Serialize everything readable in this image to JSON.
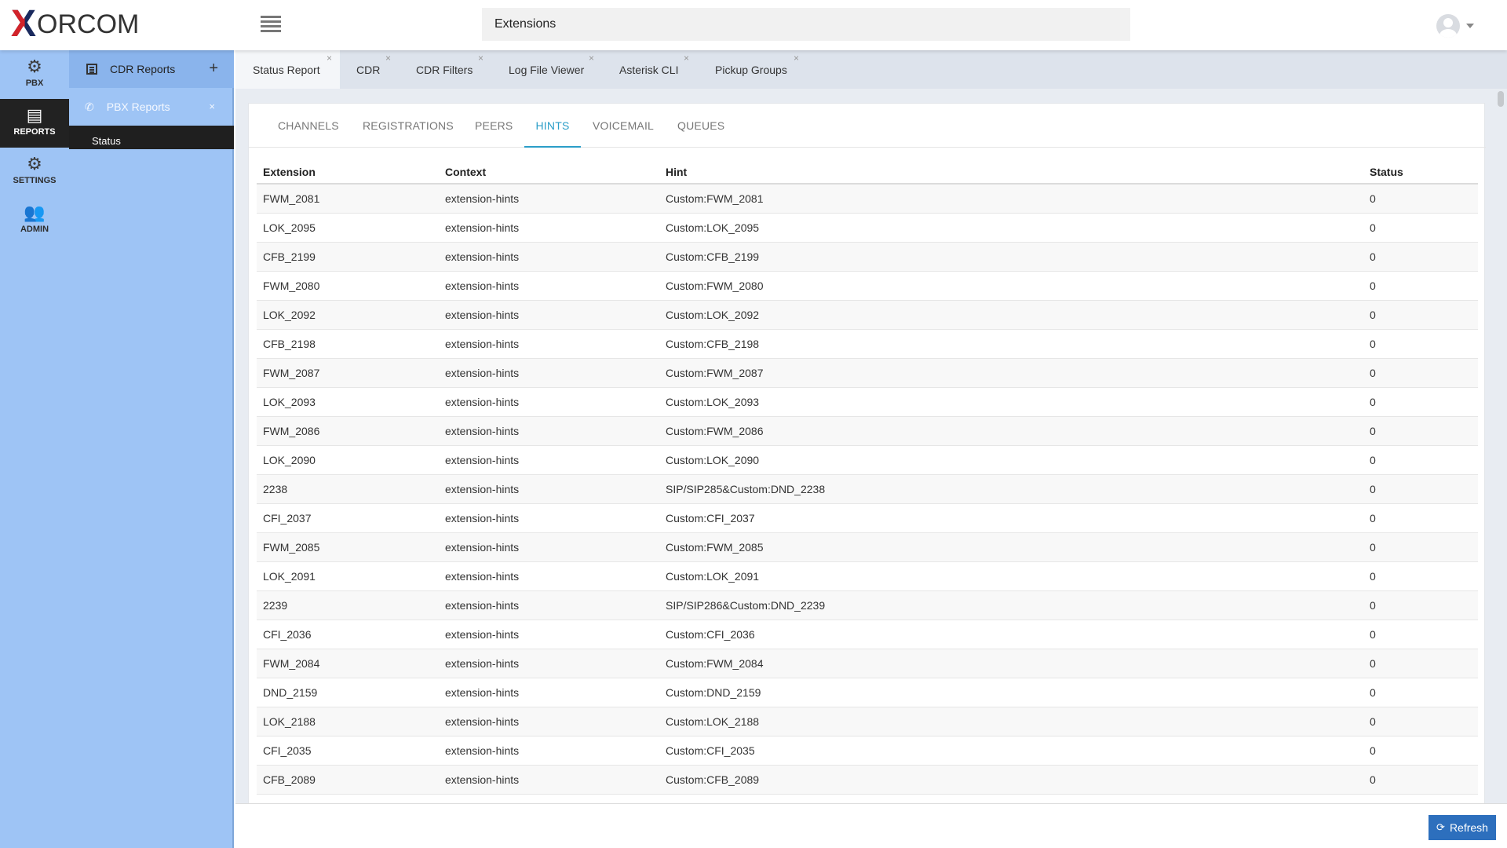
{
  "logo": {
    "x": "X",
    "text": "ORCOM"
  },
  "header": {
    "search_value": "Extensions"
  },
  "rail": [
    {
      "label": "PBX",
      "icon": "gear-icon",
      "glyph": "⚙"
    },
    {
      "label": "REPORTS",
      "icon": "document-icon",
      "glyph": "▤"
    },
    {
      "label": "SETTINGS",
      "icon": "gears-icon",
      "glyph": "⚙"
    },
    {
      "label": "ADMIN",
      "icon": "users-icon",
      "glyph": "👥"
    }
  ],
  "subnav": {
    "group_label": "CDR Reports",
    "plus": "+",
    "item_label": "PBX Reports",
    "item_close": "×",
    "leaf_label": "Status"
  },
  "tabs": [
    {
      "label": "Status Report",
      "close": "×"
    },
    {
      "label": "CDR",
      "close": "×"
    },
    {
      "label": "CDR Filters",
      "close": "×"
    },
    {
      "label": "Log File Viewer",
      "close": "×"
    },
    {
      "label": "Asterisk CLI",
      "close": "×"
    },
    {
      "label": "Pickup Groups",
      "close": "×"
    }
  ],
  "subtabs": [
    "CHANNELS",
    "REGISTRATIONS",
    "PEERS",
    "HINTS",
    "VOICEMAIL",
    "QUEUES"
  ],
  "table": {
    "columns": [
      "Extension",
      "Context",
      "Hint",
      "Status"
    ],
    "rows": [
      [
        "FWM_2081",
        "extension-hints",
        "Custom:FWM_2081",
        "0"
      ],
      [
        "LOK_2095",
        "extension-hints",
        "Custom:LOK_2095",
        "0"
      ],
      [
        "CFB_2199",
        "extension-hints",
        "Custom:CFB_2199",
        "0"
      ],
      [
        "FWM_2080",
        "extension-hints",
        "Custom:FWM_2080",
        "0"
      ],
      [
        "LOK_2092",
        "extension-hints",
        "Custom:LOK_2092",
        "0"
      ],
      [
        "CFB_2198",
        "extension-hints",
        "Custom:CFB_2198",
        "0"
      ],
      [
        "FWM_2087",
        "extension-hints",
        "Custom:FWM_2087",
        "0"
      ],
      [
        "LOK_2093",
        "extension-hints",
        "Custom:LOK_2093",
        "0"
      ],
      [
        "FWM_2086",
        "extension-hints",
        "Custom:FWM_2086",
        "0"
      ],
      [
        "LOK_2090",
        "extension-hints",
        "Custom:LOK_2090",
        "0"
      ],
      [
        "2238",
        "extension-hints",
        "SIP/SIP285&Custom:DND_2238",
        "0"
      ],
      [
        "CFI_2037",
        "extension-hints",
        "Custom:CFI_2037",
        "0"
      ],
      [
        "FWM_2085",
        "extension-hints",
        "Custom:FWM_2085",
        "0"
      ],
      [
        "LOK_2091",
        "extension-hints",
        "Custom:LOK_2091",
        "0"
      ],
      [
        "2239",
        "extension-hints",
        "SIP/SIP286&Custom:DND_2239",
        "0"
      ],
      [
        "CFI_2036",
        "extension-hints",
        "Custom:CFI_2036",
        "0"
      ],
      [
        "FWM_2084",
        "extension-hints",
        "Custom:FWM_2084",
        "0"
      ],
      [
        "DND_2159",
        "extension-hints",
        "Custom:DND_2159",
        "0"
      ],
      [
        "LOK_2188",
        "extension-hints",
        "Custom:LOK_2188",
        "0"
      ],
      [
        "CFI_2035",
        "extension-hints",
        "Custom:CFI_2035",
        "0"
      ],
      [
        "CFB_2089",
        "extension-hints",
        "Custom:CFB_2089",
        "0"
      ]
    ]
  },
  "footer": {
    "refresh_label": "Refresh"
  },
  "colors": {
    "rail": "#9ec4f5",
    "accent": "#2b9ec8",
    "button": "#2d6fbd",
    "active_rail": "#222222"
  }
}
